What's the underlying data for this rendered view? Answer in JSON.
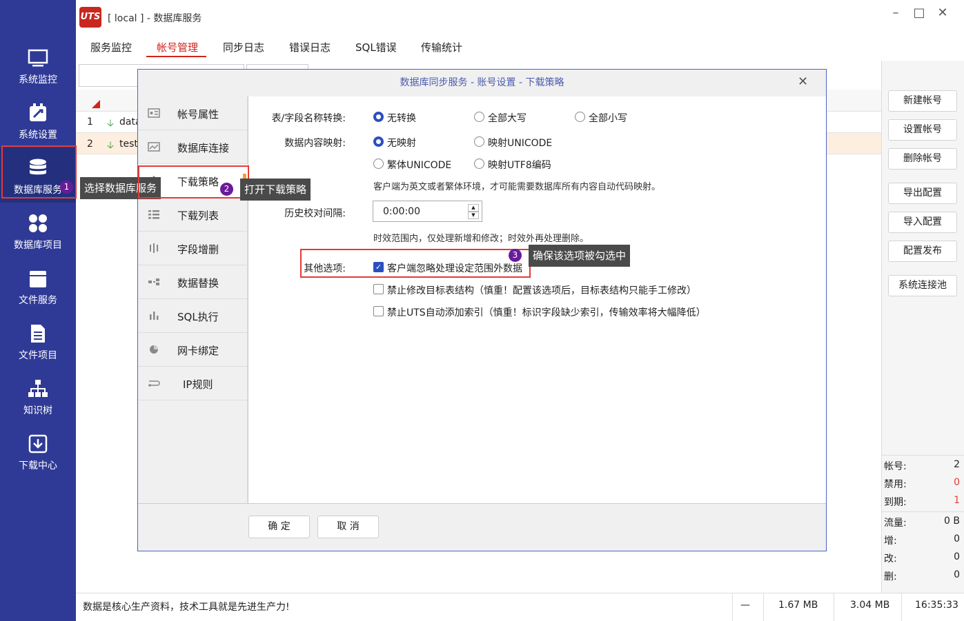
{
  "window": {
    "title": "[ local ] - 数据库服务",
    "logo": "UTS"
  },
  "sidebar": {
    "items": [
      {
        "label": "系统监控",
        "icon": "monitor-icon"
      },
      {
        "label": "系统设置",
        "icon": "settings-icon"
      },
      {
        "label": "数据库服务",
        "icon": "database-icon"
      },
      {
        "label": "数据库项目",
        "icon": "grid-icon"
      },
      {
        "label": "文件服务",
        "icon": "file-box-icon"
      },
      {
        "label": "文件项目",
        "icon": "document-list-icon"
      },
      {
        "label": "知识树",
        "icon": "tree-icon"
      },
      {
        "label": "下载中心",
        "icon": "download-icon"
      }
    ]
  },
  "tabs": [
    "服务监控",
    "帐号管理",
    "同步日志",
    "错误日志",
    "SQL错误",
    "传输统计"
  ],
  "grid": {
    "rows": [
      {
        "num": "1",
        "name": "data"
      },
      {
        "num": "2",
        "name": "testa"
      }
    ]
  },
  "right_buttons": [
    "新建帐号",
    "设置帐号",
    "删除帐号",
    "导出配置",
    "导入配置",
    "配置发布",
    "系统连接池"
  ],
  "stats": [
    {
      "label": "帐号:",
      "value": "2"
    },
    {
      "label": "禁用:",
      "value": "0"
    },
    {
      "label": "到期:",
      "value": "1"
    },
    {
      "label": "流量:",
      "value": "0 B"
    },
    {
      "label": "增:",
      "value": "0"
    },
    {
      "label": "改:",
      "value": "0"
    },
    {
      "label": "删:",
      "value": "0"
    }
  ],
  "status": {
    "message": "数据是核心生产资料，技术工具就是先进生产力!",
    "dash": "—",
    "mem1": "1.67 MB",
    "mem2": "3.04 MB",
    "time": "16:35:33"
  },
  "dialog": {
    "title": "数据库同步服务 - 账号设置 - 下载策略",
    "left_items": [
      {
        "label": "帐号属性",
        "icon": "card-icon"
      },
      {
        "label": "数据库连接",
        "icon": "chart-icon"
      },
      {
        "label": "下载策略",
        "icon": "strategy-icon"
      },
      {
        "label": "下载列表",
        "icon": "list-icon"
      },
      {
        "label": "字段增删",
        "icon": "columns-icon"
      },
      {
        "label": "数据替换",
        "icon": "replace-icon"
      },
      {
        "label": "SQL执行",
        "icon": "bar-icon"
      },
      {
        "label": "网卡绑定",
        "icon": "pie-icon"
      },
      {
        "label": "IP规则",
        "icon": "rule-icon"
      }
    ],
    "name_conv_label": "表/字段名称转换:",
    "name_conv_options": [
      "无转换",
      "全部大写",
      "全部小写"
    ],
    "map_label": "数据内容映射:",
    "map_options": [
      "无映射",
      "映射UNICODE",
      "繁体UNICODE",
      "映射UTF8编码"
    ],
    "map_hint": "客户端为英文或者繁体环境，才可能需要数据库所有内容自动代码映射。",
    "interval_label": "历史校对间隔:",
    "interval_value": "0:00:00",
    "interval_hint": "时效范围内，仅处理新增和修改；时效外再处理删除。",
    "other_label": "其他选项:",
    "other_options": [
      {
        "label": "客户端忽略处理设定范围外数据",
        "checked": true
      },
      {
        "label": "禁止修改目标表结构（慎重！配置该选项后，目标表结构只能手工修改）",
        "checked": false
      },
      {
        "label": "禁止UTS自动添加索引（慎重！标识字段缺少索引，传输效率将大幅降低）",
        "checked": false
      }
    ],
    "ok": "确 定",
    "cancel": "取 消"
  },
  "annotations": [
    {
      "num": "1",
      "text": "选择数据库服务"
    },
    {
      "num": "2",
      "text": "打开下载策略"
    },
    {
      "num": "3",
      "text": "确保该选项被勾选中"
    }
  ]
}
